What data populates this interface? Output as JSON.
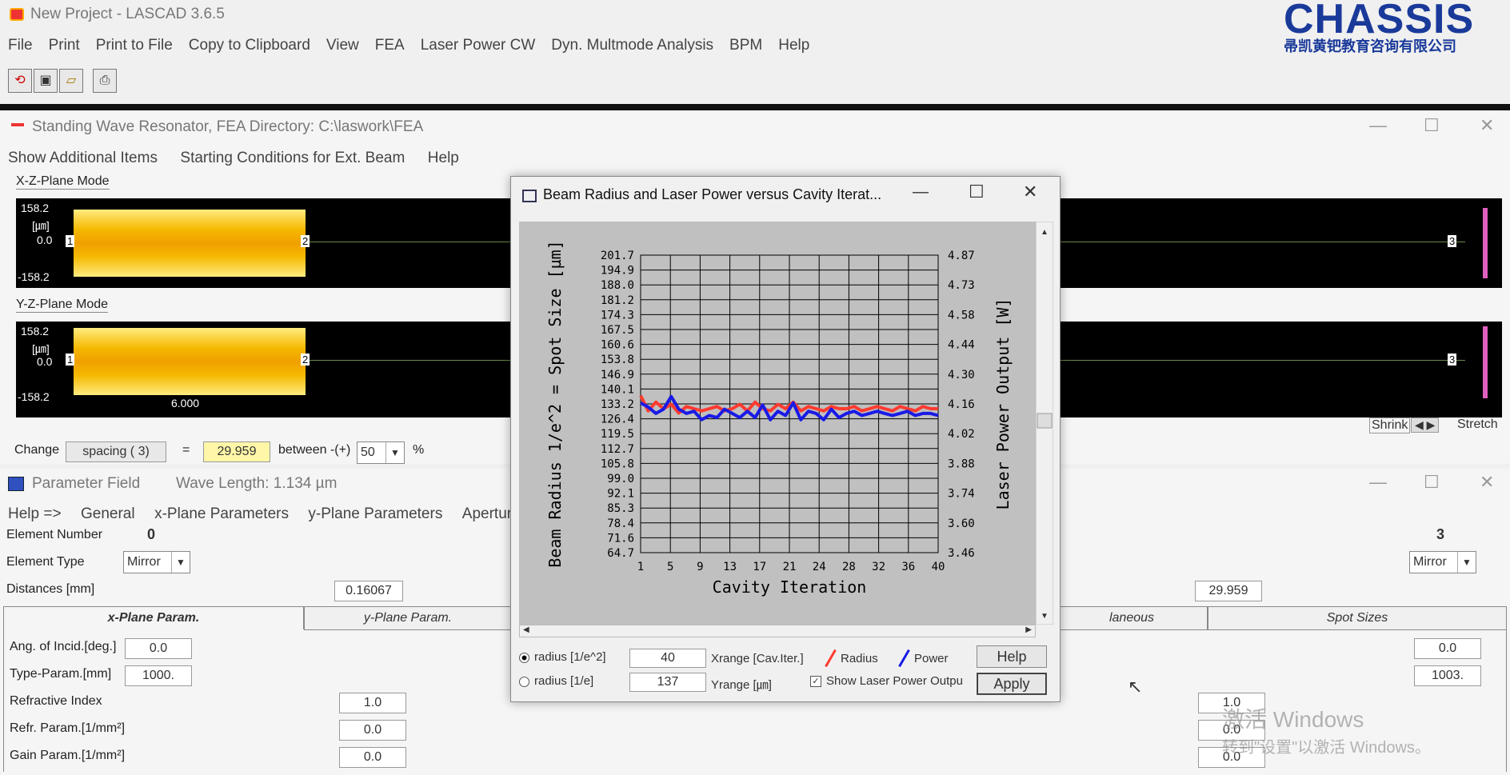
{
  "app": {
    "title": "New Project - LASCAD 3.6.5",
    "logo_text": "CHASSIS",
    "logo_sub": "帚凯黄钯教育咨询有限公司"
  },
  "menu": [
    "File",
    "Print",
    "Print to File",
    "Copy to Clipboard",
    "View",
    "FEA",
    "Laser Power CW",
    "Dyn. Multmode Analysis",
    "BPM",
    "Help"
  ],
  "toolbar_icons": [
    "refresh-icon",
    "save-icon",
    "open-folder-icon",
    "print-icon"
  ],
  "resonator": {
    "title": "Standing Wave Resonator, FEA Directory: C:\\laswork\\FEA",
    "menu": [
      "Show Additional Items",
      "Starting Conditions for Ext. Beam",
      "Help"
    ],
    "xz_label": "X-Z-Plane Mode",
    "yz_label": "Y-Z-Plane Mode",
    "top": "158.2",
    "unit": "[㎛]",
    "zero": "0.0",
    "bottom": "-158.2",
    "el1": "1",
    "el2": "2",
    "el3": "3",
    "spacing_value": "6.000",
    "shrink": "Shrink",
    "stretch": "Stretch",
    "change_label": "Change",
    "spacing": "spacing  ( 3)",
    "eq": "=",
    "change_value": "29.959",
    "between": "between  -(+)",
    "pct_value": "50",
    "pct": "%"
  },
  "param": {
    "title": "Parameter Field",
    "wavelength": "Wave Length: 1.134  µm",
    "menu": [
      "Help =>",
      "General",
      "x-Plane Parameters",
      "y-Plane Parameters",
      "Apertur"
    ],
    "element_number_label": "Element Number",
    "element_number_left": "0",
    "element_number_right": "3",
    "element_type_label": "Element Type",
    "element_type_left": "Mirror",
    "element_type_right": "Mirror",
    "distances_label": "Distances [mm]",
    "distance_left": "0.16067",
    "distance_right": "29.959",
    "tabs": [
      "x-Plane Param.",
      "y-Plane Param.",
      "laneous",
      "Spot Sizes"
    ],
    "rows": [
      {
        "label": "Ang. of Incid.[deg.]",
        "left": "0.0",
        "right": "0.0"
      },
      {
        "label": "Type-Param.[mm]",
        "left": "1000.",
        "right": "1003."
      },
      {
        "label": "Refractive Index",
        "left": "1.0",
        "right": "1.0"
      },
      {
        "label": "Refr. Param.[1/mm²]",
        "left": "0.0",
        "right": "0.0"
      },
      {
        "label": "Gain Param.[1/mm²]",
        "left": "0.0",
        "right": "0.0"
      }
    ]
  },
  "dialog": {
    "title": "Beam Radius and Laser Power versus Cavity Iterat...",
    "radio1": "radius [1/e^2]",
    "radio2": "radius [1/e]",
    "xrange_value": "40",
    "xrange_label": "Xrange [Cav.Iter.]",
    "yrange_value": "137",
    "yrange_label": "Yrange [㎛]",
    "legend_radius": "Radius",
    "legend_power": "Power",
    "show_power": "Show Laser Power Outpu",
    "help": "Help",
    "apply": "Apply"
  },
  "watermark": {
    "line1": "激活 Windows",
    "line2": "转到\"设置\"以激活 Windows。"
  },
  "colors": {
    "radius": "#ff3b30",
    "power": "#1a1ae6",
    "plot_bg": "#c0c0c0",
    "beam": "#f5b800"
  },
  "chart_data": {
    "type": "line",
    "xlabel": "Cavity Iteration",
    "ylabel": "Beam Radius 1/e^2 = Spot Size [µm]",
    "y2label": "Laser Power Output [W]",
    "xticks": [
      "1",
      "5",
      "9",
      "13",
      "17",
      "21",
      "24",
      "28",
      "32",
      "36",
      "40"
    ],
    "yticks": [
      "201.7",
      "194.9",
      "188.0",
      "181.2",
      "174.3",
      "167.5",
      "160.6",
      "153.8",
      "146.9",
      "140.1",
      "133.2",
      "126.4",
      "119.5",
      "112.7",
      "105.8",
      "99.0",
      "92.1",
      "85.3",
      "78.4",
      "71.6",
      "64.7"
    ],
    "y2ticks": [
      "4.87",
      "4.73",
      "4.58",
      "4.44",
      "4.30",
      "4.16",
      "4.02",
      "3.88",
      "3.74",
      "3.60",
      "3.46"
    ],
    "xlim": [
      1,
      40
    ],
    "ylim": [
      64.7,
      201.7
    ],
    "y2lim": [
      3.46,
      4.87
    ],
    "series": [
      {
        "name": "Radius",
        "axis": "left",
        "x": [
          1,
          2,
          3,
          4,
          5,
          6,
          7,
          8,
          9,
          10,
          11,
          12,
          13,
          14,
          15,
          16,
          17,
          18,
          19,
          20,
          21,
          22,
          23,
          24,
          25,
          26,
          27,
          28,
          29,
          30,
          31,
          32,
          33,
          34,
          35,
          36,
          37,
          38,
          39,
          40
        ],
        "values": [
          137,
          130,
          134,
          131,
          133,
          129,
          132,
          131,
          130,
          131,
          132,
          130,
          131,
          133,
          130,
          134,
          131,
          130,
          133,
          131,
          134,
          130,
          132,
          131,
          130,
          132,
          131,
          131,
          132,
          130,
          131,
          132,
          131,
          130,
          132,
          131,
          130,
          132,
          131,
          131
        ]
      },
      {
        "name": "Power",
        "axis": "right",
        "x": [
          1,
          2,
          3,
          4,
          5,
          6,
          7,
          8,
          9,
          10,
          11,
          12,
          13,
          14,
          15,
          16,
          17,
          18,
          19,
          20,
          21,
          22,
          23,
          24,
          25,
          26,
          27,
          28,
          29,
          30,
          31,
          32,
          33,
          34,
          35,
          36,
          37,
          38,
          39,
          40
        ],
        "values": [
          4.17,
          4.15,
          4.12,
          4.14,
          4.2,
          4.14,
          4.12,
          4.13,
          4.09,
          4.11,
          4.1,
          4.14,
          4.12,
          4.1,
          4.13,
          4.1,
          4.16,
          4.09,
          4.13,
          4.11,
          4.17,
          4.09,
          4.13,
          4.12,
          4.09,
          4.14,
          4.1,
          4.12,
          4.13,
          4.11,
          4.12,
          4.13,
          4.12,
          4.11,
          4.12,
          4.13,
          4.11,
          4.12,
          4.12,
          4.11
        ]
      }
    ]
  }
}
